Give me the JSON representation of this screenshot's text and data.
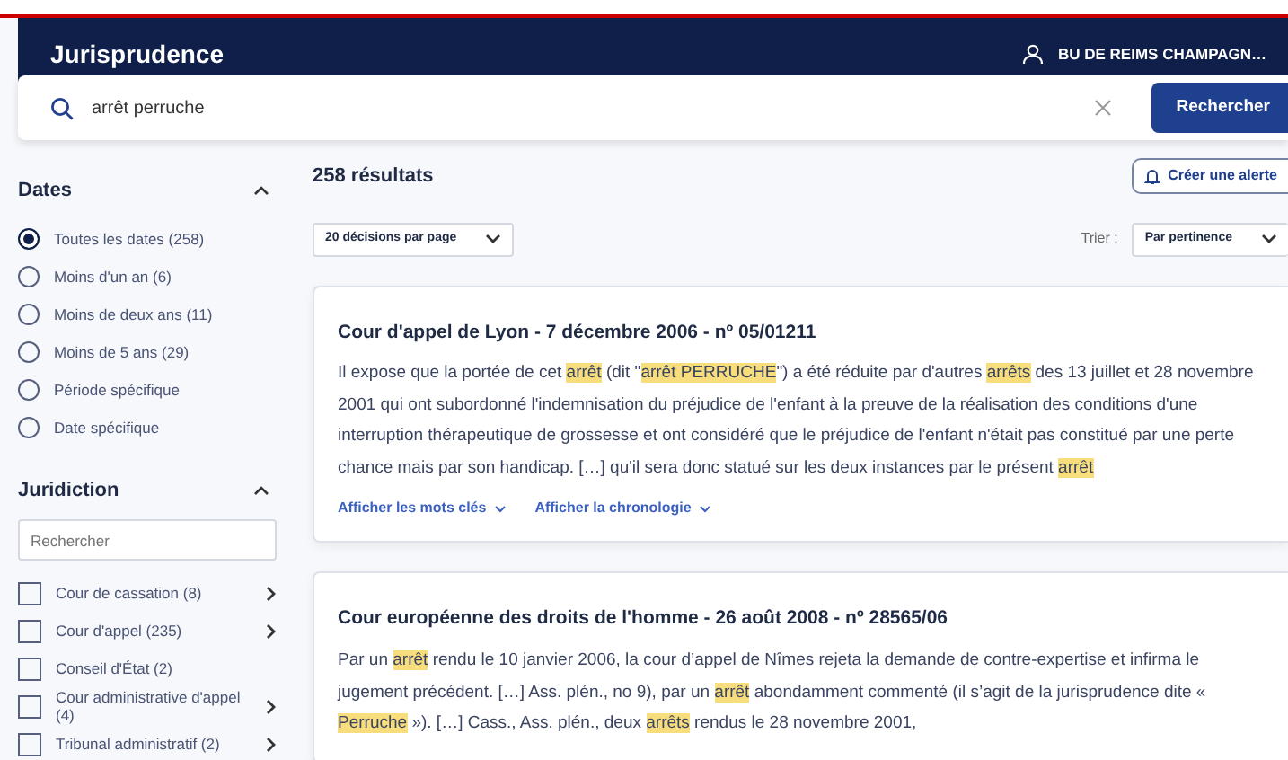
{
  "header": {
    "title": "Jurisprudence",
    "user": "BU DE REIMS CHAMPAGN…"
  },
  "search": {
    "value": "arrêt perruche",
    "button": "Rechercher"
  },
  "sidebar": {
    "dates": {
      "title": "Dates",
      "expanded": true,
      "options": [
        {
          "label": "Toutes les dates (258)",
          "selected": true
        },
        {
          "label": "Moins d'un an (6)",
          "selected": false
        },
        {
          "label": "Moins de deux ans (11)",
          "selected": false
        },
        {
          "label": "Moins de 5 ans (29)",
          "selected": false
        },
        {
          "label": "Période spécifique",
          "selected": false
        },
        {
          "label": "Date spécifique",
          "selected": false
        }
      ]
    },
    "juridiction": {
      "title": "Juridiction",
      "expanded": true,
      "placeholder": "Rechercher",
      "items": [
        {
          "label": "Cour de cassation (8)",
          "checked": false,
          "has_children": true
        },
        {
          "label": "Cour d'appel (235)",
          "checked": false,
          "has_children": true
        },
        {
          "label": "Conseil d'État (2)",
          "checked": false,
          "has_children": false
        },
        {
          "label": "Cour administrative d'appel (4)",
          "checked": false,
          "has_children": true
        },
        {
          "label": "Tribunal administratif (2)",
          "checked": false,
          "has_children": true
        }
      ]
    }
  },
  "results": {
    "count": "258 résultats",
    "alert_button": "Créer une alerte",
    "per_page": "20 décisions par page",
    "sort_label": "Trier :",
    "sort_value": "Par pertinence",
    "items": [
      {
        "title": "Cour d'appel de Lyon - 7 décembre 2006 - nº 05/01211",
        "snippet": [
          {
            "text": "Il expose que la portée de cet ",
            "highlight": false
          },
          {
            "text": "arrêt",
            "highlight": true
          },
          {
            "text": " (dit \"",
            "highlight": false
          },
          {
            "text": "arrêt PERRUCHE",
            "highlight": true
          },
          {
            "text": "\") a été réduite par d'autres ",
            "highlight": false
          },
          {
            "text": "arrêts",
            "highlight": true
          },
          {
            "text": " des 13 juillet et 28 novembre 2001 qui ont subordonné l'indemnisation du préjudice de l'enfant à la preuve de la réalisation des conditions d'une interruption thérapeutique de grossesse et ont considéré que le préjudice de l'enfant n'était pas constitué par une perte chance mais par son handicap. […] qu'il sera donc statué sur les deux instances par le présent ",
            "highlight": false
          },
          {
            "text": "arrêt",
            "highlight": true
          }
        ],
        "links": [
          "Afficher les mots clés",
          "Afficher la chronologie"
        ]
      },
      {
        "title": "Cour européenne des droits de l'homme - 26 août 2008 - nº 28565/06",
        "snippet": [
          {
            "text": "Par un ",
            "highlight": false
          },
          {
            "text": "arrêt",
            "highlight": true
          },
          {
            "text": " rendu le 10 janvier 2006, la cour d’appel de Nîmes rejeta la demande de contre-expertise et infirma le jugement précédent. […] Ass. plén., no 9), par un ",
            "highlight": false
          },
          {
            "text": "arrêt",
            "highlight": true
          },
          {
            "text": " abondamment commenté (il s’agit de la jurisprudence dite « ",
            "highlight": false
          },
          {
            "text": "Perruche",
            "highlight": true
          },
          {
            "text": " »). […] Cass., Ass. plén., deux ",
            "highlight": false
          },
          {
            "text": "arrêts",
            "highlight": true
          },
          {
            "text": " rendus le 28 novembre 2001,",
            "highlight": false
          }
        ]
      }
    ]
  }
}
